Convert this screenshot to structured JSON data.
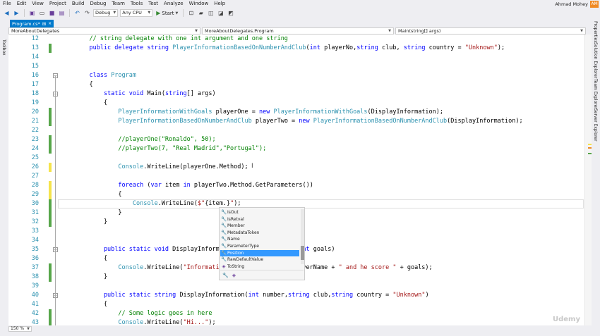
{
  "menu": [
    "File",
    "Edit",
    "View",
    "Project",
    "Build",
    "Debug",
    "Team",
    "Tools",
    "Test",
    "Analyze",
    "Window",
    "Help"
  ],
  "user": {
    "name": "Ahmad Mohey",
    "initials": "AM"
  },
  "toolbar": {
    "config": "Debug",
    "platform": "Any CPU",
    "start_label": "Start",
    "icons": [
      "back-icon",
      "forward-icon",
      "new-project-icon",
      "open-icon",
      "save-icon",
      "save-all-icon",
      "undo-icon",
      "redo-icon",
      "bookmark-icon",
      "bookmark-prev-icon",
      "bookmark-next-icon",
      "bookmark-clear-icon"
    ]
  },
  "side": {
    "left": [
      "Toolbox"
    ],
    "right": [
      "Properties",
      "Solution Explorer",
      "Team Explorer",
      "Server Explorer"
    ]
  },
  "tabs": [
    {
      "label": "Program.cs*",
      "pin": "⊞",
      "close": "×"
    }
  ],
  "navbar": {
    "project": "MoreAboutDelegates",
    "class": "MoreAboutDelegates.Program",
    "member": "Main(string[] args)"
  },
  "editor": {
    "lines": [
      {
        "n": "12",
        "tokens": [
          [
            "cm",
            "    // string delegate with one int argument and one string"
          ]
        ]
      },
      {
        "n": "13",
        "tokens": [
          [
            "kw",
            "    public delegate string "
          ],
          [
            "ty",
            "PlayerInformationBasedOnNumberAndClub"
          ],
          [
            "",
            "("
          ],
          [
            "kw",
            "int"
          ],
          [
            "",
            " playerNo,"
          ],
          [
            "kw",
            "string"
          ],
          [
            "",
            " club, "
          ],
          [
            "kw",
            "string"
          ],
          [
            "",
            " country = "
          ],
          [
            "str",
            "\"Unknown\""
          ],
          [
            "",
            ");"
          ]
        ]
      },
      {
        "n": "14",
        "tokens": []
      },
      {
        "n": "15",
        "tokens": []
      },
      {
        "n": "16",
        "tokens": [
          [
            "kw",
            "    class "
          ],
          [
            "ty",
            "Program"
          ]
        ]
      },
      {
        "n": "17",
        "tokens": [
          [
            "",
            "    {"
          ]
        ]
      },
      {
        "n": "18",
        "tokens": [
          [
            "kw",
            "        static void "
          ],
          [
            "",
            "Main("
          ],
          [
            "kw",
            "string"
          ],
          [
            "",
            "[] args)"
          ]
        ]
      },
      {
        "n": "19",
        "tokens": [
          [
            "",
            "        {"
          ]
        ]
      },
      {
        "n": "20",
        "tokens": [
          [
            "ty",
            "            PlayerInformationWithGoals"
          ],
          [
            "",
            " playerOne = "
          ],
          [
            "kw",
            "new "
          ],
          [
            "ty",
            "PlayerInformationWithGoals"
          ],
          [
            "",
            "(DisplayInformation);"
          ]
        ]
      },
      {
        "n": "21",
        "tokens": [
          [
            "ty",
            "            PlayerInformationBasedOnNumberAndClub"
          ],
          [
            "",
            " playerTwo = "
          ],
          [
            "kw",
            "new "
          ],
          [
            "ty",
            "PlayerInformationBasedOnNumberAndClub"
          ],
          [
            "",
            "(DisplayInformation);"
          ]
        ]
      },
      {
        "n": "22",
        "tokens": []
      },
      {
        "n": "23",
        "tokens": [
          [
            "cm",
            "            //playerOne(\"Ronaldo\", 50);"
          ]
        ]
      },
      {
        "n": "24",
        "tokens": [
          [
            "cm",
            "            //playerTwo(7, \"Real Madrid\",\"Portugal\");"
          ]
        ]
      },
      {
        "n": "25",
        "tokens": []
      },
      {
        "n": "26",
        "tokens": [
          [
            "ty",
            "            Console"
          ],
          [
            "",
            ".WriteLine(playerOne.Method);"
          ]
        ]
      },
      {
        "n": "27",
        "tokens": []
      },
      {
        "n": "28",
        "tokens": [
          [
            "kw",
            "            foreach "
          ],
          [
            "",
            "("
          ],
          [
            "kw",
            "var"
          ],
          [
            "",
            " item "
          ],
          [
            "kw",
            "in"
          ],
          [
            "",
            " playerTwo.Method.GetParameters())"
          ]
        ]
      },
      {
        "n": "29",
        "tokens": [
          [
            "",
            "            {"
          ]
        ]
      },
      {
        "n": "30",
        "tokens": [
          [
            "ty",
            "                Console"
          ],
          [
            "",
            ".WriteLine("
          ],
          [
            "str",
            "$\""
          ],
          [
            "",
            "{item.}"
          ],
          [
            "str",
            "\""
          ],
          [
            "",
            ");"
          ]
        ]
      },
      {
        "n": "31",
        "tokens": [
          [
            "",
            "            }"
          ]
        ]
      },
      {
        "n": "32",
        "tokens": [
          [
            "",
            "        }"
          ]
        ]
      },
      {
        "n": "33",
        "tokens": []
      },
      {
        "n": "34",
        "tokens": []
      },
      {
        "n": "35",
        "tokens": [
          [
            "kw",
            "        public static void "
          ],
          [
            "",
            "DisplayInformat"
          ],
          [
            "",
            "                    "
          ],
          [
            "kw",
            "int"
          ],
          [
            "",
            " goals)"
          ]
        ]
      },
      {
        "n": "36",
        "tokens": [
          [
            "",
            "        {"
          ]
        ]
      },
      {
        "n": "37",
        "tokens": [
          [
            "ty",
            "            Console"
          ],
          [
            "",
            ".WriteLine("
          ],
          [
            "str",
            "\"Information"
          ],
          [
            "",
            "                    ayerName + "
          ],
          [
            "str",
            "\" and he score \""
          ],
          [
            "",
            " + goals);"
          ]
        ]
      },
      {
        "n": "38",
        "tokens": [
          [
            "",
            "        }"
          ]
        ]
      },
      {
        "n": "39",
        "tokens": []
      },
      {
        "n": "40",
        "tokens": [
          [
            "kw",
            "        public static string "
          ],
          [
            "",
            "DisplayInformation("
          ],
          [
            "kw",
            "int"
          ],
          [
            "",
            " number,"
          ],
          [
            "kw",
            "string"
          ],
          [
            "",
            " club,"
          ],
          [
            "kw",
            "string"
          ],
          [
            "",
            " country = "
          ],
          [
            "str",
            "\"Unknown\""
          ],
          [
            "",
            ")"
          ]
        ]
      },
      {
        "n": "41",
        "tokens": [
          [
            "",
            "        {"
          ]
        ]
      },
      {
        "n": "42",
        "tokens": [
          [
            "cm",
            "            // Some logic goes in here"
          ]
        ]
      },
      {
        "n": "43",
        "tokens": [
          [
            "ty",
            "            Console"
          ],
          [
            "",
            ".WriteLine("
          ],
          [
            "str",
            "\"Hi...\""
          ],
          [
            "",
            ");"
          ]
        ]
      }
    ]
  },
  "intellisense": {
    "items": [
      {
        "icon": "wrench-icon",
        "glyph": "🔧",
        "label": "IsOut",
        "selected": false
      },
      {
        "icon": "wrench-icon",
        "glyph": "🔧",
        "label": "IsRetval",
        "selected": false
      },
      {
        "icon": "wrench-icon",
        "glyph": "🔧",
        "label": "Member",
        "selected": false
      },
      {
        "icon": "wrench-icon",
        "glyph": "🔧",
        "label": "MetadataToken",
        "selected": false
      },
      {
        "icon": "wrench-icon",
        "glyph": "🔧",
        "label": "Name",
        "selected": false
      },
      {
        "icon": "wrench-icon",
        "glyph": "🔧",
        "label": "ParameterType",
        "selected": false
      },
      {
        "icon": "wrench-icon",
        "glyph": "🔧",
        "label": "Position",
        "selected": true
      },
      {
        "icon": "wrench-icon",
        "glyph": "🔧",
        "label": "RawDefaultValue",
        "selected": false
      },
      {
        "icon": "method-icon",
        "glyph": "◈",
        "label": "ToString",
        "selected": false
      }
    ],
    "filters": [
      {
        "icon": "property-filter-icon",
        "glyph": "🔧"
      },
      {
        "icon": "method-filter-icon",
        "glyph": "◈"
      }
    ]
  },
  "zoom": "150 %",
  "colors": {
    "accent": "#007acc",
    "selection": "#3399ff",
    "changed_saved": "#57a64a",
    "changed_unsaved": "#f5e34b"
  }
}
